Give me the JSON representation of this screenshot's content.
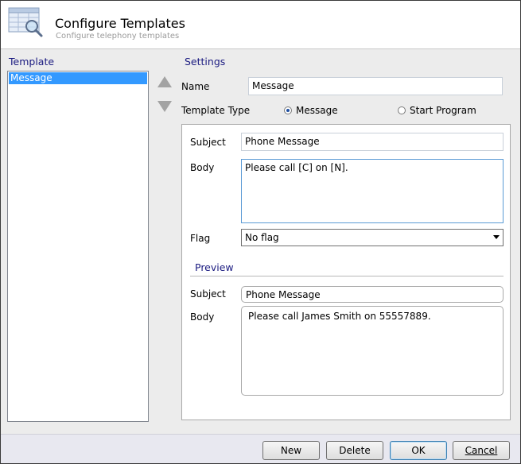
{
  "header": {
    "title": "Configure Templates",
    "subtitle": "Configure telephony templates"
  },
  "template_panel": {
    "label": "Template",
    "items": [
      {
        "label": "Message",
        "selected": true
      }
    ]
  },
  "settings": {
    "label": "Settings",
    "name_label": "Name",
    "name_value": "Message",
    "type_label": "Template Type",
    "type_options": [
      {
        "label": "Message",
        "checked": true
      },
      {
        "label": "Start Program",
        "checked": false
      }
    ],
    "subject_label": "Subject",
    "subject_value": "Phone Message",
    "body_label": "Body",
    "body_value": "Please call [C] on [N].",
    "flag_label": "Flag",
    "flag_value": "No flag"
  },
  "preview": {
    "label": "Preview",
    "subject_label": "Subject",
    "subject_value": "Phone Message",
    "body_label": "Body",
    "body_value": "Please call James Smith on 55557889."
  },
  "footer": {
    "new_label": "New",
    "delete_label": "Delete",
    "ok_label": "OK",
    "cancel_label": "Cancel"
  },
  "colors": {
    "accent": "#3399ff",
    "section_label": "#1a1a80"
  }
}
